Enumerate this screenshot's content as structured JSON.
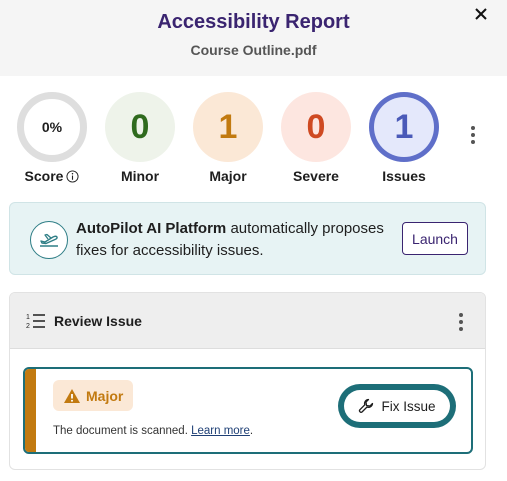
{
  "header": {
    "title": "Accessibility Report",
    "subtitle": "Course Outline.pdf"
  },
  "stats": [
    {
      "label": "Score",
      "value": "0%"
    },
    {
      "label": "Minor",
      "value": "0"
    },
    {
      "label": "Major",
      "value": "1"
    },
    {
      "label": "Severe",
      "value": "0"
    },
    {
      "label": "Issues",
      "value": "1"
    }
  ],
  "banner": {
    "bold_text": "AutoPilot AI Platform",
    "text": " automatically proposes fixes for accessibility issues.",
    "button_label": "Launch"
  },
  "review": {
    "title": "Review Issue",
    "issue": {
      "severity": "Major",
      "description": "The document is scanned. ",
      "link_text": "Learn more",
      "suffix": ".",
      "fix_label": "Fix Issue"
    }
  },
  "colors": {
    "title": "#3a2470",
    "minor": "#2f6a1e",
    "major": "#c27a10",
    "severe": "#cf4a22",
    "issues": "#5f6fc9",
    "accent_teal": "#1d6e78"
  }
}
